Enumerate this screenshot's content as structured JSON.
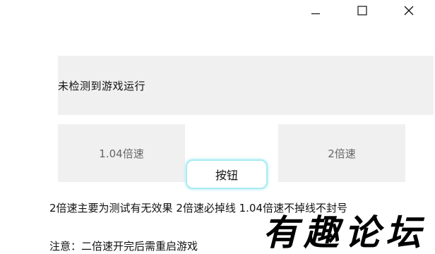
{
  "window": {
    "controls": {
      "minimize_icon": "minimize-icon",
      "maximize_icon": "maximize-icon",
      "close_icon": "close-icon"
    }
  },
  "status": {
    "text": "未检测到游戏运行"
  },
  "buttons": {
    "speed_104": "1.04倍速",
    "speed_2": "2倍速",
    "main": "按钮"
  },
  "description": "2倍速主要为测试有无效果 2倍速必掉线 1.04倍速不掉线不封号",
  "note": "注意：二倍速开完后需重启游戏",
  "watermark": {
    "text": "有趣论坛"
  }
}
